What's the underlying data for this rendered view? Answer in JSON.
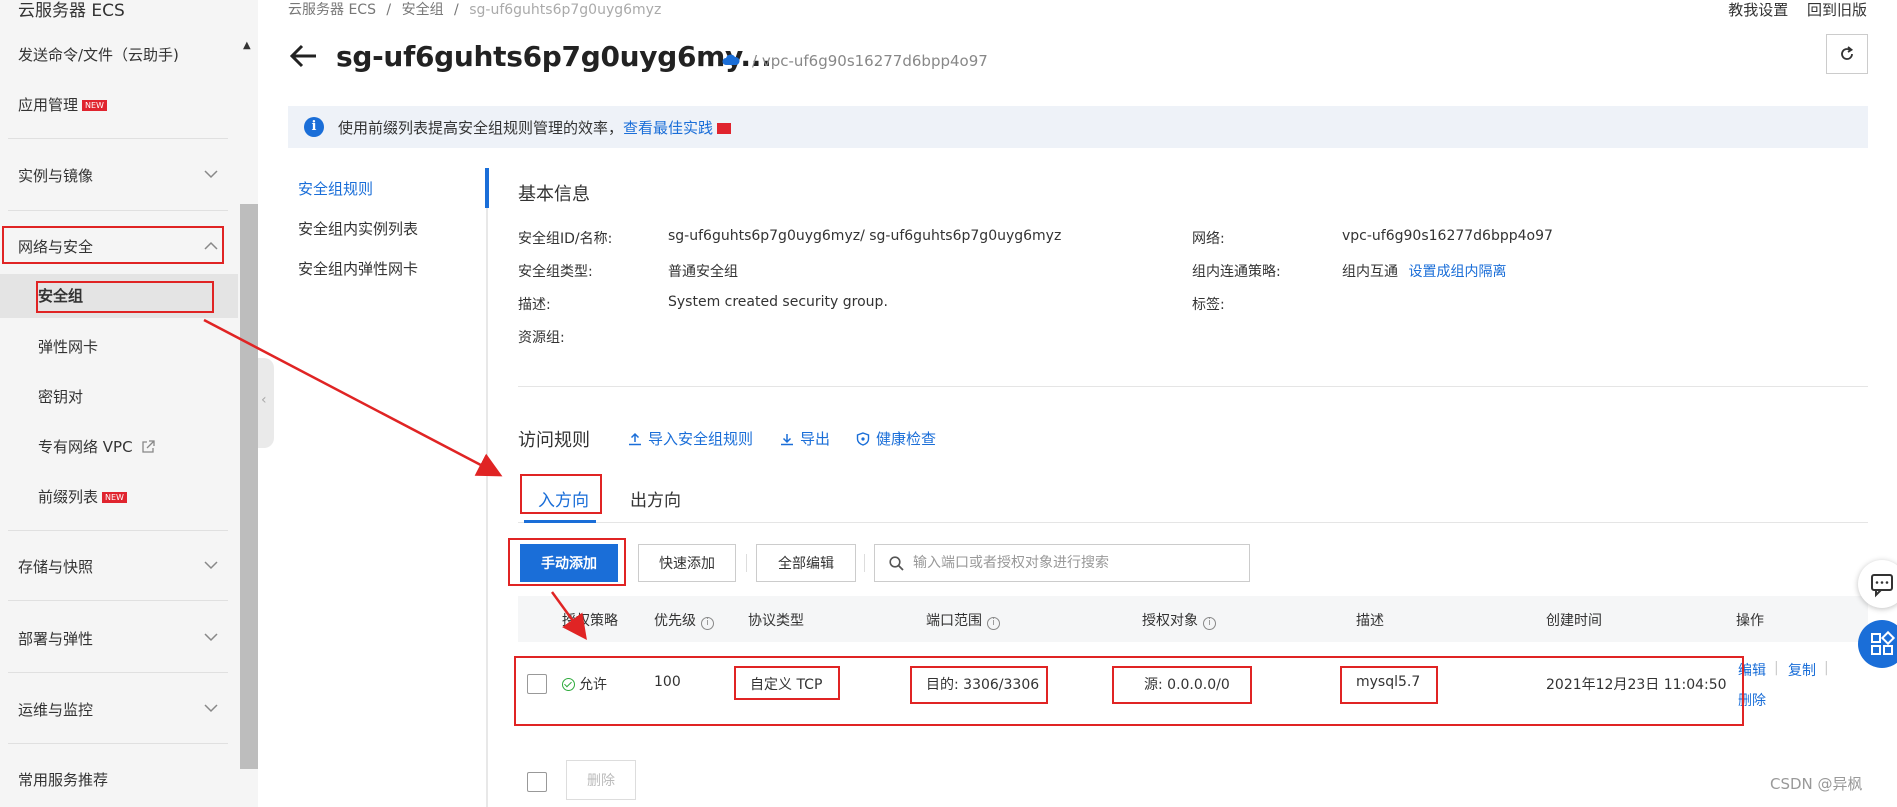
{
  "sidebar": {
    "title": "云服务器 ECS",
    "items": [
      {
        "label": "发送命令/文件（云助手)"
      },
      {
        "label": "应用管理",
        "badge": "NEW"
      },
      {
        "label": "实例与镜像"
      },
      {
        "label": "网络与安全"
      },
      {
        "label": "存储与快照"
      },
      {
        "label": "部署与弹性"
      },
      {
        "label": "运维与监控"
      },
      {
        "label": "常用服务推荐"
      }
    ],
    "network_sub": [
      {
        "label": "安全组"
      },
      {
        "label": "弹性网卡"
      },
      {
        "label": "密钥对"
      },
      {
        "label": "专有网络 VPC"
      },
      {
        "label": "前缀列表",
        "badge": "NEW"
      }
    ]
  },
  "breadcrumb": {
    "p1": "云服务器 ECS",
    "sep": "/",
    "p2": "安全组",
    "p3": "sg-uf6guhts6p7g0uyg6myz"
  },
  "top_links": {
    "tutorial": "教我设置",
    "old": "回到旧版"
  },
  "header": {
    "title": "sg-uf6guhts6p7g0uyg6my...",
    "vpc": "/ vpc-uf6g90s16277d6bpp4o97"
  },
  "info_bar": {
    "text": "使用前缀列表提高安全组规则管理的效率，",
    "link": "查看最佳实践"
  },
  "subnav": {
    "rules": "安全组规则",
    "instances": "安全组内实例列表",
    "eni": "安全组内弹性网卡"
  },
  "basic": {
    "title": "基本信息",
    "id_label": "安全组ID/名称:",
    "id_value": "sg-uf6guhts6p7g0uyg6myz/ sg-uf6guhts6p7g0uyg6myz",
    "type_label": "安全组类型:",
    "type_value": "普通安全组",
    "desc_label": "描述:",
    "desc_value": "System created security group.",
    "rg_label": "资源组:",
    "net_label": "网络:",
    "net_value": "vpc-uf6g90s16277d6bpp4o97",
    "policy_label": "组内连通策略:",
    "policy_value": "组内互通",
    "policy_link": "设置成组内隔离",
    "tag_label": "标签:"
  },
  "rules": {
    "title": "访问规则",
    "import": "导入安全组规则",
    "export": "导出",
    "health": "健康检查",
    "tab_in": "入方向",
    "tab_out": "出方向",
    "btn_manual": "手动添加",
    "btn_quick": "快速添加",
    "btn_edit_all": "全部编辑",
    "search_placeholder": "输入端口或者授权对象进行搜索",
    "columns": {
      "policy": "授权策略",
      "priority": "优先级",
      "protocol": "协议类型",
      "port": "端口范围",
      "auth": "授权对象",
      "desc": "描述",
      "created": "创建时间",
      "ops": "操作"
    },
    "row": {
      "policy": "允许",
      "priority": "100",
      "protocol": "自定义 TCP",
      "port": "目的: 3306/3306",
      "auth": "源: 0.0.0.0/0",
      "desc": "mysql5.7",
      "created": "2021年12月23日 11:04:50",
      "op_edit": "编辑",
      "op_copy": "复制",
      "op_delete": "删除"
    },
    "delete_btn": "删除"
  },
  "watermark": "CSDN @异枫",
  "colors": {
    "accent": "#1a6ed8",
    "annotation": "#e02424",
    "allow": "#2eaa3c"
  }
}
